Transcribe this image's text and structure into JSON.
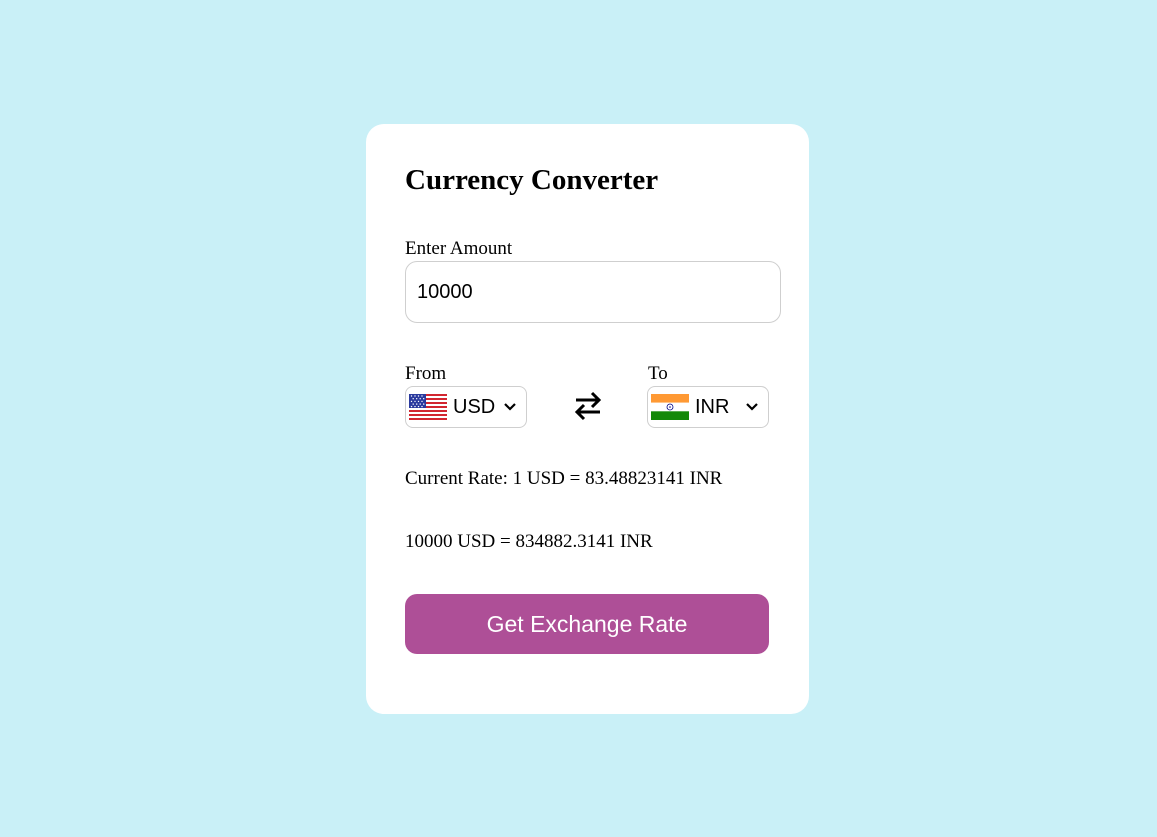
{
  "converter": {
    "title": "Currency Converter",
    "amount_label": "Enter Amount",
    "amount_value": "10000",
    "from_label": "From",
    "to_label": "To",
    "from_currency": "USD",
    "to_currency": "INR",
    "current_rate": "Current Rate: 1 USD = 83.48823141 INR",
    "result": "10000 USD = 834882.3141 INR",
    "button_label": "Get Exchange Rate"
  },
  "icons": {
    "from_flag": "us-flag-icon",
    "to_flag": "india-flag-icon",
    "swap": "swap-arrows-icon",
    "dropdown": "chevron-down-icon"
  },
  "colors": {
    "page_background": "#c9f0f7",
    "card_background": "#ffffff",
    "button_background": "#ae4f97",
    "button_text": "#ffffff"
  }
}
